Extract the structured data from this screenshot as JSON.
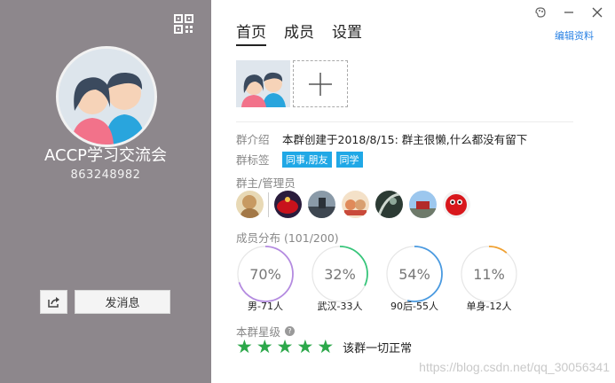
{
  "left_panel": {
    "group_name": "ACCP学习交流会",
    "group_id": "863248982",
    "send_message_label": "发消息"
  },
  "tabs": [
    {
      "label": "首页",
      "active": true
    },
    {
      "label": "成员",
      "active": false
    },
    {
      "label": "设置",
      "active": false
    }
  ],
  "edit_profile_label": "编辑资料",
  "intro": {
    "label": "群介绍",
    "text": "本群创建于2018/8/15: 群主很懒,什么都没有留下"
  },
  "tags": {
    "label": "群标签",
    "items": [
      "同事,朋友",
      "同学"
    ]
  },
  "admins": {
    "title": "群主/管理员",
    "avatars": [
      "owner-avatar",
      "admin-avatar-1",
      "admin-avatar-2",
      "admin-avatar-3",
      "admin-avatar-4",
      "admin-avatar-5",
      "admin-avatar-6"
    ]
  },
  "distribution": {
    "title": "成员分布 (101/200)",
    "items": [
      {
        "percent": "70%",
        "value": 0.7,
        "label": "男-71人",
        "color": "#b48be0"
      },
      {
        "percent": "32%",
        "value": 0.32,
        "label": "武汉-33人",
        "color": "#37c57a"
      },
      {
        "percent": "54%",
        "value": 0.54,
        "label": "90后-55人",
        "color": "#4a9ae0"
      },
      {
        "percent": "11%",
        "value": 0.11,
        "label": "单身-12人",
        "color": "#f0a030"
      }
    ]
  },
  "rating": {
    "title": "本群星级",
    "stars": 5,
    "text": "该群一切正常"
  },
  "watermark": "https://blog.csdn.net/qq_30056341",
  "colors": {
    "accent": "#2a82e4",
    "tag": "#20a8e6",
    "star": "#2ca84a",
    "left_bg": "#8d878c"
  }
}
